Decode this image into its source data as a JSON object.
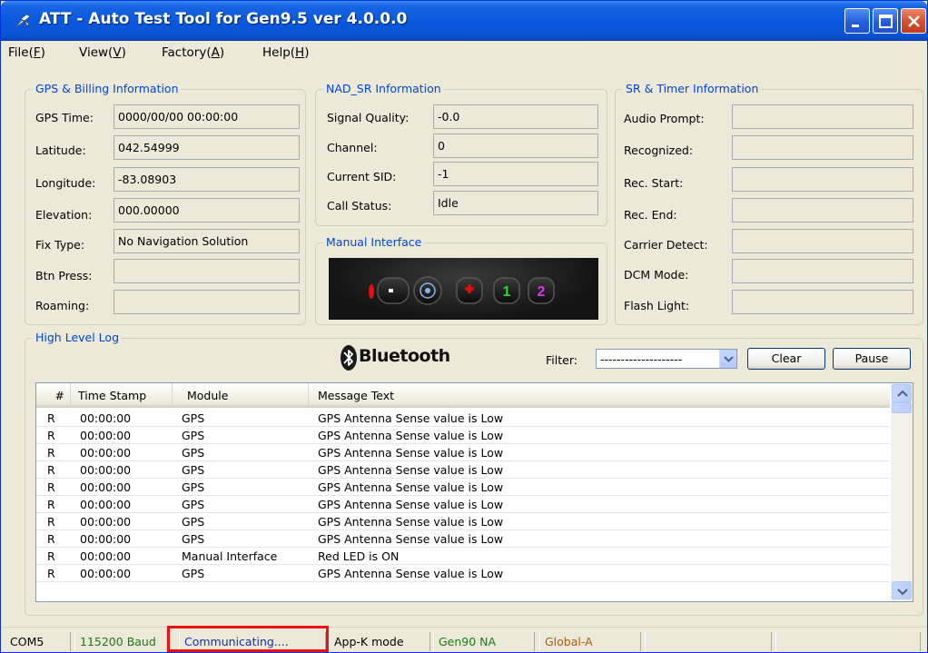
{
  "window": {
    "title": "ATT - Auto Test Tool for Gen9.5 ver 4.0.0.0"
  },
  "menu": [
    {
      "label": "File(",
      "key": "F",
      "suffix": ")"
    },
    {
      "label": "View(",
      "key": "V",
      "suffix": ")"
    },
    {
      "label": "Factory(",
      "key": "A",
      "suffix": ")"
    },
    {
      "label": "Help(",
      "key": "H",
      "suffix": ")"
    }
  ],
  "gps": {
    "title": "GPS & Billing Information",
    "fields": [
      {
        "label": "GPS Time:",
        "value": "0000/00/00 00:00:00"
      },
      {
        "label": "Latitude:",
        "value": "042.54999"
      },
      {
        "label": "Longitude:",
        "value": "-83.08903"
      },
      {
        "label": "Elevation:",
        "value": "000.00000"
      },
      {
        "label": "Fix Type:",
        "value": "No Navigation Solution"
      },
      {
        "label": "Btn Press:",
        "value": ""
      },
      {
        "label": "Roaming:",
        "value": ""
      }
    ]
  },
  "nad": {
    "title": "NAD_SR Information",
    "fields": [
      {
        "label": "Signal Quality:",
        "value": "-0.0"
      },
      {
        "label": "Channel:",
        "value": "0"
      },
      {
        "label": "Current SID:",
        "value": "-1"
      },
      {
        "label": "Call Status:",
        "value": "Idle"
      }
    ]
  },
  "manual": {
    "title": "Manual Interface",
    "button_1": "1",
    "button_2": "2",
    "colors": {
      "red_led": "#e01010",
      "button_1": "#22dd22",
      "button_2": "#dd33ee"
    }
  },
  "sr": {
    "title": "SR & Timer Information",
    "fields": [
      {
        "label": "Audio Prompt:",
        "value": ""
      },
      {
        "label": "Recognized:",
        "value": ""
      },
      {
        "label": "Rec. Start:",
        "value": ""
      },
      {
        "label": "Rec. End:",
        "value": ""
      },
      {
        "label": "Carrier Detect:",
        "value": ""
      },
      {
        "label": "DCM Mode:",
        "value": ""
      },
      {
        "label": "Flash Light:",
        "value": ""
      }
    ]
  },
  "log": {
    "title": "High Level Log",
    "bluetooth": "Bluetooth",
    "filter_label": "Filter:",
    "filter_value": "--------------------",
    "clear_label": "Clear",
    "pause_label": "Pause",
    "columns": [
      "#",
      "Time Stamp",
      "Module",
      "Message Text"
    ],
    "rows": [
      [
        "R",
        "00:00:00",
        "GPS",
        "GPS Antenna Sense value is Low"
      ],
      [
        "R",
        "00:00:00",
        "GPS",
        "GPS Antenna Sense value is Low"
      ],
      [
        "R",
        "00:00:00",
        "GPS",
        "GPS Antenna Sense value is Low"
      ],
      [
        "R",
        "00:00:00",
        "GPS",
        "GPS Antenna Sense value is Low"
      ],
      [
        "R",
        "00:00:00",
        "GPS",
        "GPS Antenna Sense value is Low"
      ],
      [
        "R",
        "00:00:00",
        "GPS",
        "GPS Antenna Sense value is Low"
      ],
      [
        "R",
        "00:00:00",
        "GPS",
        "GPS Antenna Sense value is Low"
      ],
      [
        "R",
        "00:00:00",
        "GPS",
        "GPS Antenna Sense value is Low"
      ],
      [
        "R",
        "00:00:00",
        "Manual Interface",
        "Red LED is ON"
      ],
      [
        "R",
        "00:00:00",
        "GPS",
        "GPS Antenna Sense value is Low"
      ]
    ]
  },
  "status": {
    "port": "COM5",
    "baud": "115200 Baud",
    "state": "Communicating....",
    "mode": "App-K mode",
    "gen": "Gen90 NA",
    "region": "Global-A",
    "colors": {
      "baud": "#1a7a1a",
      "state": "#1030c0",
      "gen": "#1a7a1a",
      "region": "#a06010",
      "highlight": "#ee1010"
    }
  }
}
